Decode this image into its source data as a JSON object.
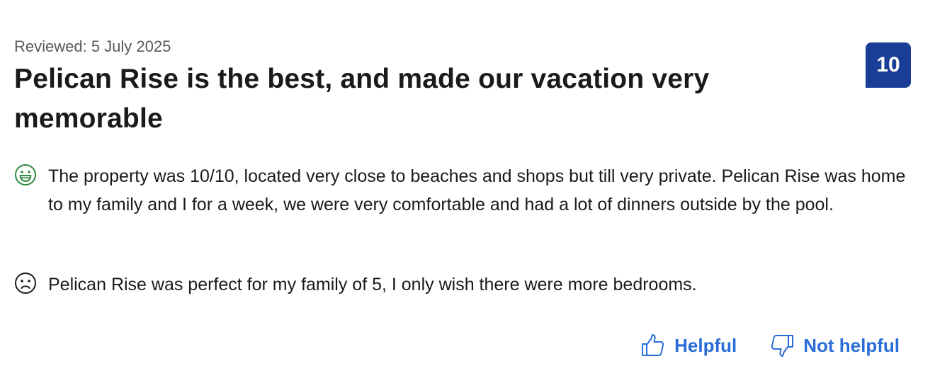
{
  "review": {
    "reviewed_date": "Reviewed: 5 July 2025",
    "title": "Pelican Rise is the best, and made our vacation very memorable",
    "score": "10",
    "positive_text": "The property was 10/10, located very close to beaches and shops but till very private. Pelican Rise was home to my family and I for a week, we were very comfortable and had a lot of dinners outside by the pool.",
    "negative_text": "Pelican Rise was perfect for my family of 5, I only wish there were more bedrooms.",
    "positive_icon": "smile-icon",
    "negative_icon": "frown-icon"
  },
  "actions": {
    "helpful_label": "Helpful",
    "not_helpful_label": "Not helpful",
    "helpful_icon": "thumbs-up-icon",
    "not_helpful_icon": "thumbs-down-icon"
  },
  "colors": {
    "score_badge": "#1a3e97",
    "positive_icon": "#2e8b3d",
    "negative_icon": "#1a1a1a",
    "action_link": "#2a6dd6",
    "meta_text": "#595959"
  }
}
